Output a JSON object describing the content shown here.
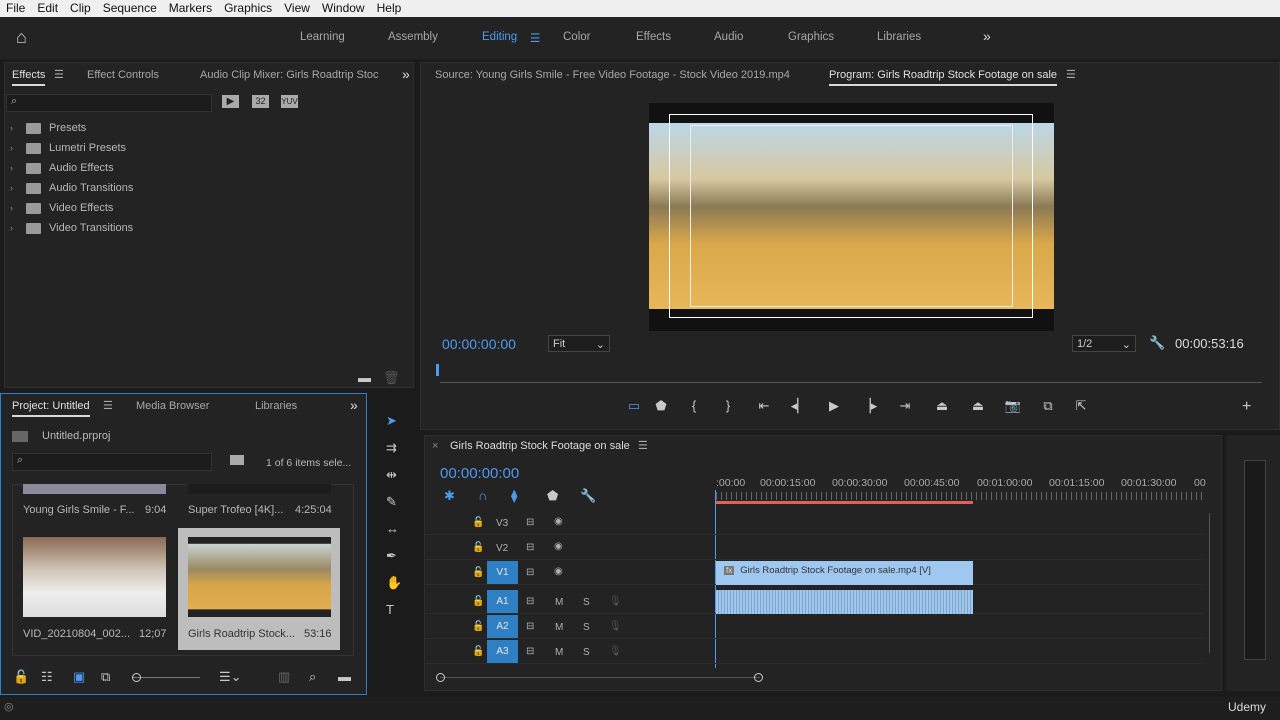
{
  "menu": [
    "File",
    "Edit",
    "Clip",
    "Sequence",
    "Markers",
    "Graphics",
    "View",
    "Window",
    "Help"
  ],
  "workspaces": [
    {
      "label": "Learning"
    },
    {
      "label": "Assembly"
    },
    {
      "label": "Editing",
      "active": true
    },
    {
      "label": "Color"
    },
    {
      "label": "Effects"
    },
    {
      "label": "Audio"
    },
    {
      "label": "Graphics"
    },
    {
      "label": "Libraries"
    }
  ],
  "effects_panel": {
    "tabs": [
      "Effects",
      "Effect Controls",
      "Audio Clip Mixer: Girls Roadtrip Stoc"
    ],
    "filter_buttons": [
      "32",
      "YUV"
    ],
    "items": [
      "Presets",
      "Lumetri Presets",
      "Audio Effects",
      "Audio Transitions",
      "Video Effects",
      "Video Transitions"
    ]
  },
  "monitor": {
    "source_tab": "Source: Young Girls Smile - Free Video Footage - Stock Video 2019.mp4",
    "program_tab": "Program: Girls Roadtrip Stock Footage on sale",
    "timecode": "00:00:00:00",
    "fit": "Fit",
    "resolution": "1/2",
    "duration": "00:00:53:16"
  },
  "project": {
    "tabs": [
      "Project: Untitled",
      "Media Browser",
      "Libraries"
    ],
    "file": "Untitled.prproj",
    "selection": "1 of 6 items sele...",
    "items": [
      {
        "name": "Young Girls Smile - F...",
        "duration": "9:04"
      },
      {
        "name": "Super Trofeo [4K]...",
        "duration": "4:25:04"
      },
      {
        "name": "VID_20210804_002...",
        "duration": "12;07"
      },
      {
        "name": "Girls Roadtrip Stock...",
        "duration": "53:16",
        "selected": true
      }
    ]
  },
  "timeline": {
    "title": "Girls Roadtrip Stock Footage on sale",
    "timecode": "00:00:00:00",
    "ruler": [
      ":00:00",
      "00:00:15:00",
      "00:00:30:00",
      "00:00:45:00",
      "00:01:00:00",
      "00:01:15:00",
      "00:01:30:00",
      "00"
    ],
    "video_tracks": [
      "V3",
      "V2",
      "V1"
    ],
    "audio_tracks": [
      "A1",
      "A2",
      "A3"
    ],
    "mute": "M",
    "solo": "S",
    "clip_label": "Girls Roadtrip Stock Footage on sale.mp4 [V]"
  },
  "status": {
    "watermark": "Udemy"
  },
  "colors": {
    "accent": "#4c9bf0",
    "track_target": "#2f7fc4",
    "clip": "#9fc8f0",
    "work_area": "#e0605a"
  }
}
